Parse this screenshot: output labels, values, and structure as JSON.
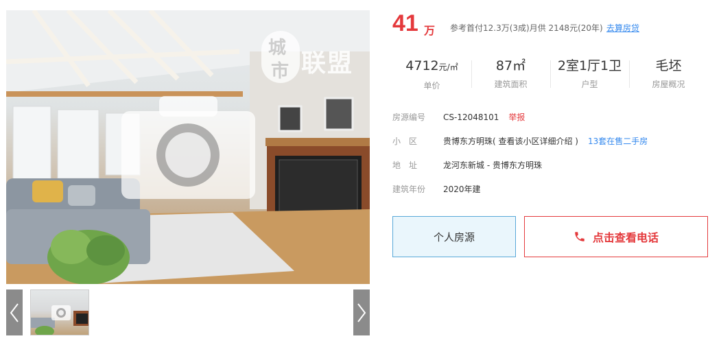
{
  "watermark": {
    "char_top": "城",
    "char_bottom": "市",
    "brand": "联盟"
  },
  "gallery": {
    "prev_icon": "chevron-left-icon",
    "next_icon": "chevron-right-icon",
    "placeholder_icon": "camera-icon"
  },
  "price": {
    "value": "41",
    "unit": "万",
    "reference": "参考首付12.3万(3成)月供 2148元(20年)",
    "loan_link": "去算房贷",
    "color": "#e4393c"
  },
  "stats": [
    {
      "value": "4712",
      "unit": "元/㎡",
      "label": "单价"
    },
    {
      "value": "87㎡",
      "unit": "",
      "label": "建筑面积"
    },
    {
      "value": "2室1厅1卫",
      "unit": "",
      "label": "户型"
    },
    {
      "value": "毛坯",
      "unit": "",
      "label": "房屋概况"
    }
  ],
  "details": {
    "listing_id": {
      "key": "房源编号",
      "value": "CS-12048101",
      "action": "举报"
    },
    "community": {
      "key": "小　区",
      "value": "贵博东方明珠( 查看该小区详细介绍 )",
      "action": "13套在售二手房"
    },
    "address": {
      "key": "地　址",
      "value": "龙河东新城 - 贵博东方明珠"
    },
    "build_year": {
      "key": "建筑年份",
      "value": "2020年建"
    }
  },
  "actions": {
    "personal": "个人房源",
    "phone": "点击查看电话",
    "phone_icon": "phone-icon"
  }
}
